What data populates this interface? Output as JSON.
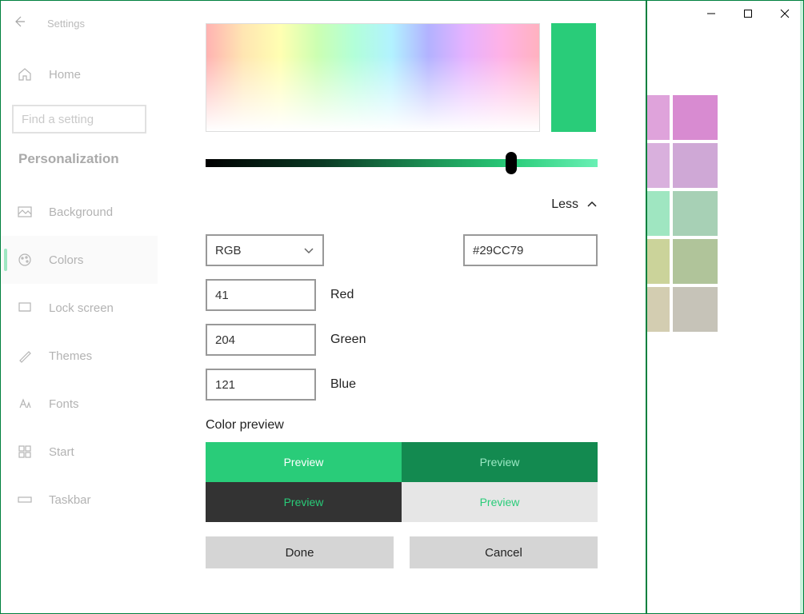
{
  "header": {
    "title": "Settings"
  },
  "search": {
    "placeholder": "Find a setting"
  },
  "section": "Personalization",
  "sidebar": {
    "home": "Home",
    "items": [
      {
        "label": "Background"
      },
      {
        "label": "Colors"
      },
      {
        "label": "Lock screen"
      },
      {
        "label": "Themes"
      },
      {
        "label": "Fonts"
      },
      {
        "label": "Start"
      },
      {
        "label": "Taskbar"
      }
    ]
  },
  "picker": {
    "less": "Less",
    "mode": "RGB",
    "hex": "#29CC79",
    "r": "41",
    "g": "204",
    "b": "121",
    "r_label": "Red",
    "g_label": "Green",
    "b_label": "Blue",
    "preview_head": "Color preview",
    "preview_label": "Preview",
    "done": "Done",
    "cancel": "Cancel",
    "accent": "#29CC79"
  },
  "swatches": [
    "#dfa3db",
    "#d88bd1",
    "#d9b0dd",
    "#cfa8d6",
    "#9fe6c1",
    "#a7d0b5",
    "#cbd39a",
    "#b0c49a",
    "#d3cdb1",
    "#c6c3b8"
  ]
}
